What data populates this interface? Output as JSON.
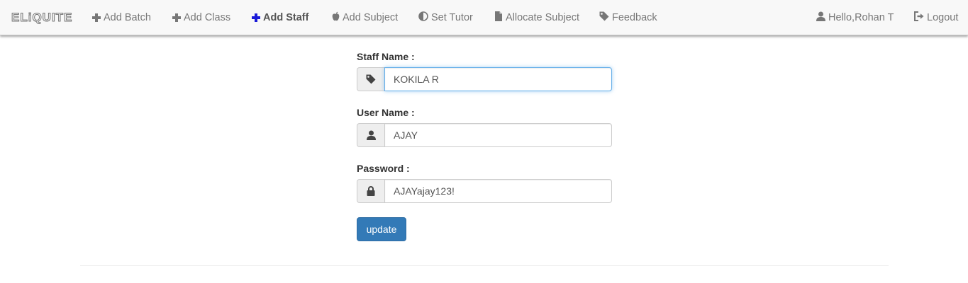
{
  "navbar": {
    "brand": "ELiQUITE",
    "items": [
      {
        "label": "Add Batch",
        "icon": "plus-icon"
      },
      {
        "label": "Add Class",
        "icon": "plus-icon"
      },
      {
        "label": "Add Staff",
        "icon": "plus-icon",
        "active": true
      },
      {
        "label": "Add Subject",
        "icon": "apple-icon"
      },
      {
        "label": "Set Tutor",
        "icon": "adjust-icon"
      },
      {
        "label": "Allocate Subject",
        "icon": "file-icon"
      },
      {
        "label": "Feedback",
        "icon": "tag-icon"
      }
    ],
    "user_greeting": "Hello,Rohan T",
    "logout_label": "Logout"
  },
  "form": {
    "staff_name": {
      "label": "Staff Name :",
      "value": "KOKILA R",
      "icon": "tag-icon"
    },
    "user_name": {
      "label": "User Name :",
      "value": "AJAY",
      "icon": "user-icon"
    },
    "password": {
      "label": "Password :",
      "value": "AJAYajay123!",
      "icon": "lock-icon"
    },
    "submit_label": "update"
  },
  "colors": {
    "active_nav_icon": "#1a1ad8",
    "primary_button": "#337ab7",
    "focus_border": "#66afe9"
  }
}
